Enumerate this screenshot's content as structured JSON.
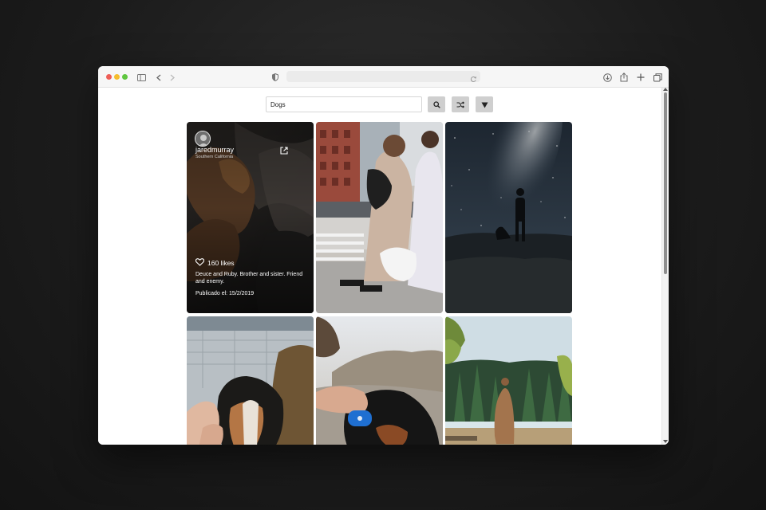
{
  "browser": {
    "traffic_lights": {
      "close": "#ee5e57",
      "minimize": "#f5bd2e",
      "zoom": "#5fc63f"
    },
    "icons": [
      "sidebar-icon",
      "back-icon",
      "forward-icon",
      "privacy-shield-icon",
      "reload-icon",
      "download-icon",
      "share-icon",
      "new-tab-icon",
      "tabs-overview-icon"
    ]
  },
  "search": {
    "value": "Dogs",
    "placeholder": ""
  },
  "buttons": {
    "search_icon": "search-icon",
    "shuffle_icon": "shuffle-icon",
    "filter_icon": "filter-icon"
  },
  "featured_post": {
    "username": "jaredmurray",
    "location": "Southern California",
    "likes": "160 likes",
    "caption": "Deuce and Ruby. Brother and sister. Friend and enemy.",
    "published": "Publicado el: 15/2/2019"
  },
  "grid": {
    "photos": [
      {
        "subject": "sleeping dogs on bed"
      },
      {
        "subject": "couple laughing with dogs on street"
      },
      {
        "subject": "silhouette with dog under milky way"
      },
      {
        "subject": "hands petting dog"
      },
      {
        "subject": "dog with blue toy"
      },
      {
        "subject": "person in forest"
      }
    ]
  }
}
